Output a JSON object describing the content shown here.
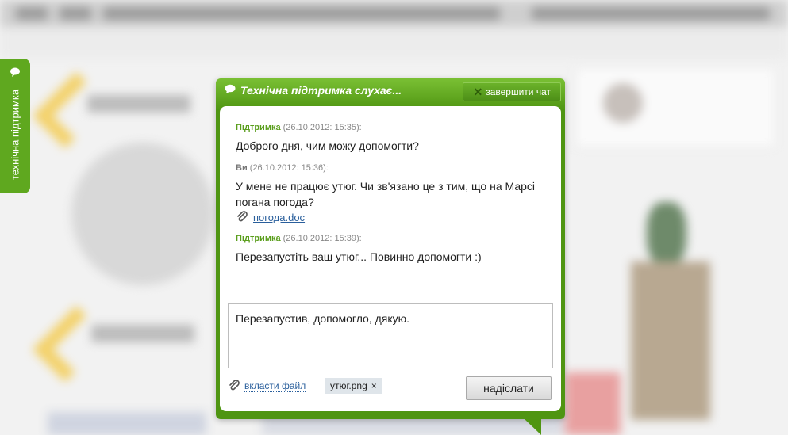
{
  "side_tab": {
    "label": "технічна підтримка"
  },
  "chat": {
    "title": "Технічна підтримка слухає...",
    "end_chat_label": "завершити чат",
    "messages": [
      {
        "author": "Підтримка",
        "time": "(26.10.2012: 15:35):",
        "text": "Доброго дня, чим можу допомогти?"
      },
      {
        "author": "Ви",
        "time": "(26.10.2012: 15:36):",
        "text": "У мене не працює утюг. Чи зв'язано це з тим, що на Марсі погана погода?",
        "attachment": "погода.doc"
      },
      {
        "author": "Підтримка",
        "time": "(26.10.2012: 15:39):",
        "text": "Перезапустіть ваш утюг... Повинно допомогти :)"
      }
    ],
    "input_value": "Перезапустив, допомогло, дякую.",
    "attach_file_label": "вкласти файл",
    "attached_file": "утюг.png",
    "remove_file_symbol": "×",
    "send_label": "надіслати"
  },
  "colors": {
    "accent_green": "#5fa81f",
    "link_blue": "#2a5f9c"
  }
}
